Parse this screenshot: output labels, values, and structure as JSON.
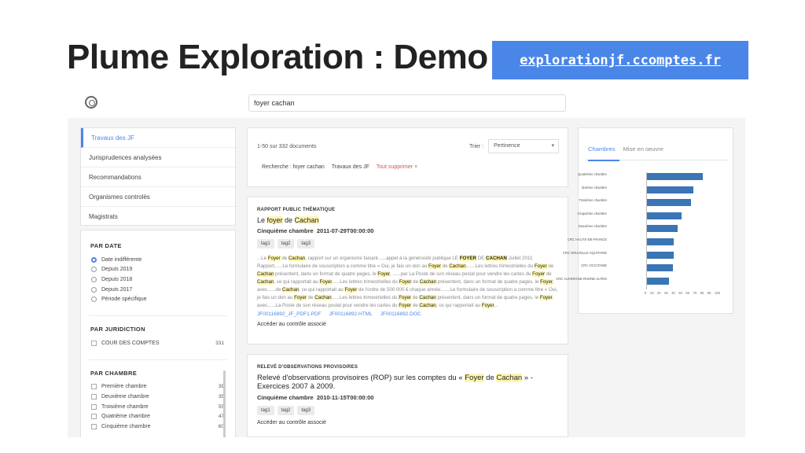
{
  "slide": {
    "title": "Plume Exploration : Demo",
    "url": "explorationjf.ccomptes.fr"
  },
  "search": {
    "value": "foyer cachan"
  },
  "sidebar_nav": [
    {
      "label": "Travaux des JF",
      "active": true
    },
    {
      "label": "Jurisprudences analysées",
      "active": false
    },
    {
      "label": "Recommandations",
      "active": false
    },
    {
      "label": "Organismes controlés",
      "active": false
    },
    {
      "label": "Magistrats",
      "active": false
    }
  ],
  "filters": {
    "date": {
      "heading": "PAR DATE",
      "options": [
        "Date indifférente",
        "Depuis 2019",
        "Depuis 2018",
        "Depuis 2017",
        "Période spécifique"
      ],
      "selected_index": 0
    },
    "juridiction": {
      "heading": "PAR JURIDICTION",
      "items": [
        {
          "label": "COUR DES COMPTES",
          "count": "331"
        }
      ]
    },
    "chambre": {
      "heading": "PAR CHAMBRE",
      "items": [
        {
          "label": "Première chambre",
          "count": "39"
        },
        {
          "label": "Deuxième chambre",
          "count": "35"
        },
        {
          "label": "Troisième chambre",
          "count": "55"
        },
        {
          "label": "Quatrième chambre",
          "count": "47"
        },
        {
          "label": "Cinquième chambre",
          "count": "60"
        }
      ]
    }
  },
  "results_header": {
    "count": "1-50 sur 332 documents",
    "sort_label": "Trier :",
    "sort_value": "Pertinence",
    "crumb_search": "Recherche : foyer cachan",
    "crumb_filter": "Travaux des JF",
    "clear_all": "Tout supprimer",
    "clear_icon": "×"
  },
  "result1": {
    "type": "RAPPORT PUBLIC THÉMATIQUE",
    "title_pre": "Le ",
    "title_hl1": "foyer",
    "title_mid": " de ",
    "title_hl2": "Cachan",
    "chambre": "Cinquième chambre",
    "date": "2011-07-29T00:00:00",
    "tags": [
      "tag1",
      "tag2",
      "tag3"
    ],
    "excerpt": "...Le Foyer de Cachan, rapport sur un organisme faisant......appel à la générosité publique LE FOYER DE CACHAN Juillet 2011 Rapport......Le formulaire de souscription a comme titre « Oui, je fais un don au Foyer de Cachan.......Les lettres trimestrielles du Foyer de Cachan présentent, dans un format de quatre pages, le Foyer, ......par La Poste de son réseau postal pour vendre les cartes du Foyer de Cachan, ce qui rapportait au Foyer......Les lettres trimestrielles du Foyer de Cachan présentent, dans un format de quatre pages, le Foyer, avec......de Cachan, ce qui rapportait au Foyer de l'ordre de 500 000 € chaque année.......Le formulaire de souscription a comme titre « Oui, je fais un don au Foyer de Cachan......Les lettres trimestrielles du Foyer de Cachan présentent, dans un format de quatre pages, le Foyer, avec......La Poste de son réseau postal pour vendre les cartes du Foyer de Cachan, ce qui rapportait au Foyer...",
    "links": [
      "JF00116892_JF_PDF1.PDF",
      "JF00116892.HTML",
      "JF00116892.DOC"
    ],
    "access": "Accéder au contrôle associé"
  },
  "result2": {
    "type": "RELEVÉ D'OBSERVATIONS PROVISOIRES",
    "title_pre": "Relevé d'observations provisoires (ROP) sur les comptes du « ",
    "title_hl1": "Foyer",
    "title_mid": " de ",
    "title_hl2": "Cachan",
    "title_post": " » - Exercices 2007 à 2009.",
    "chambre": "Cinquième chambre",
    "date": "2010-11-15T00:00:00",
    "tags": [
      "tag1",
      "tag2",
      "tag3"
    ],
    "access": "Accéder au contrôle associé"
  },
  "chart_panel": {
    "tabs": [
      "Chambres",
      "Mise en oeuvre"
    ],
    "active_tab": 0,
    "accent": "#4a86e8",
    "bar_color": "#3a75b5"
  },
  "chart_data": {
    "type": "bar",
    "orientation": "horizontal",
    "categories": [
      "Quatrième chambre",
      "Sixième chambre",
      "Troisième chambre",
      "Cinquième chambre",
      "Deuxième chambre",
      "CRC HAUTS-DE-FRANCE",
      "CRC NOUVELLE-AQUITAINE",
      "CRC OCCITANIE",
      "CRC AUVERGNE-RHONE-ALPES"
    ],
    "values": [
      84,
      70,
      66,
      52,
      46,
      41,
      41,
      40,
      34
    ],
    "xlabel": "",
    "ylabel": "",
    "x_tick_labels": [
      "0",
      "10",
      "20",
      "30",
      "40",
      "50",
      "60",
      "70",
      "80",
      "90",
      "100"
    ],
    "grid": false,
    "legend": "none"
  }
}
